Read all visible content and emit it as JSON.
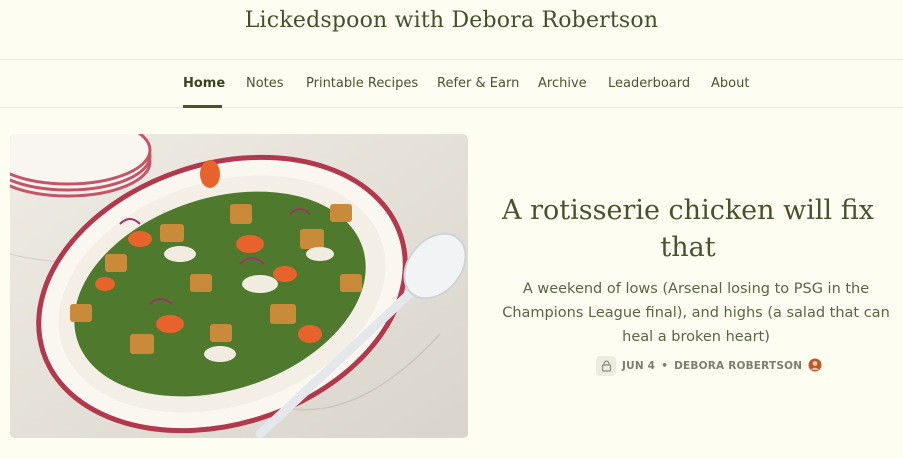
{
  "site": {
    "title": "Lickedspoon with Debora Robertson"
  },
  "nav": {
    "items": [
      {
        "label": "Home",
        "active": true
      },
      {
        "label": "Notes"
      },
      {
        "label": "Printable Recipes"
      },
      {
        "label": "Refer & Earn"
      },
      {
        "label": "Archive"
      },
      {
        "label": "Leaderboard"
      },
      {
        "label": "About"
      }
    ]
  },
  "post": {
    "title": "A rotisserie chicken will fix that",
    "subtitle": "A weekend of lows (Arsenal losing to PSG in the Champions League final), and highs (a salad that can heal a broken heart)",
    "date": "JUN 4",
    "separator": "•",
    "author": "DEBORA ROBERTSON",
    "paywall_icon": "lock-icon",
    "author_avatar": "avatar-icon",
    "image_alt": "Rotisserie chicken panzanella salad on a platter"
  },
  "colors": {
    "background": "#fdfdf1",
    "accent": "#4a5428",
    "title": "#47532c"
  }
}
